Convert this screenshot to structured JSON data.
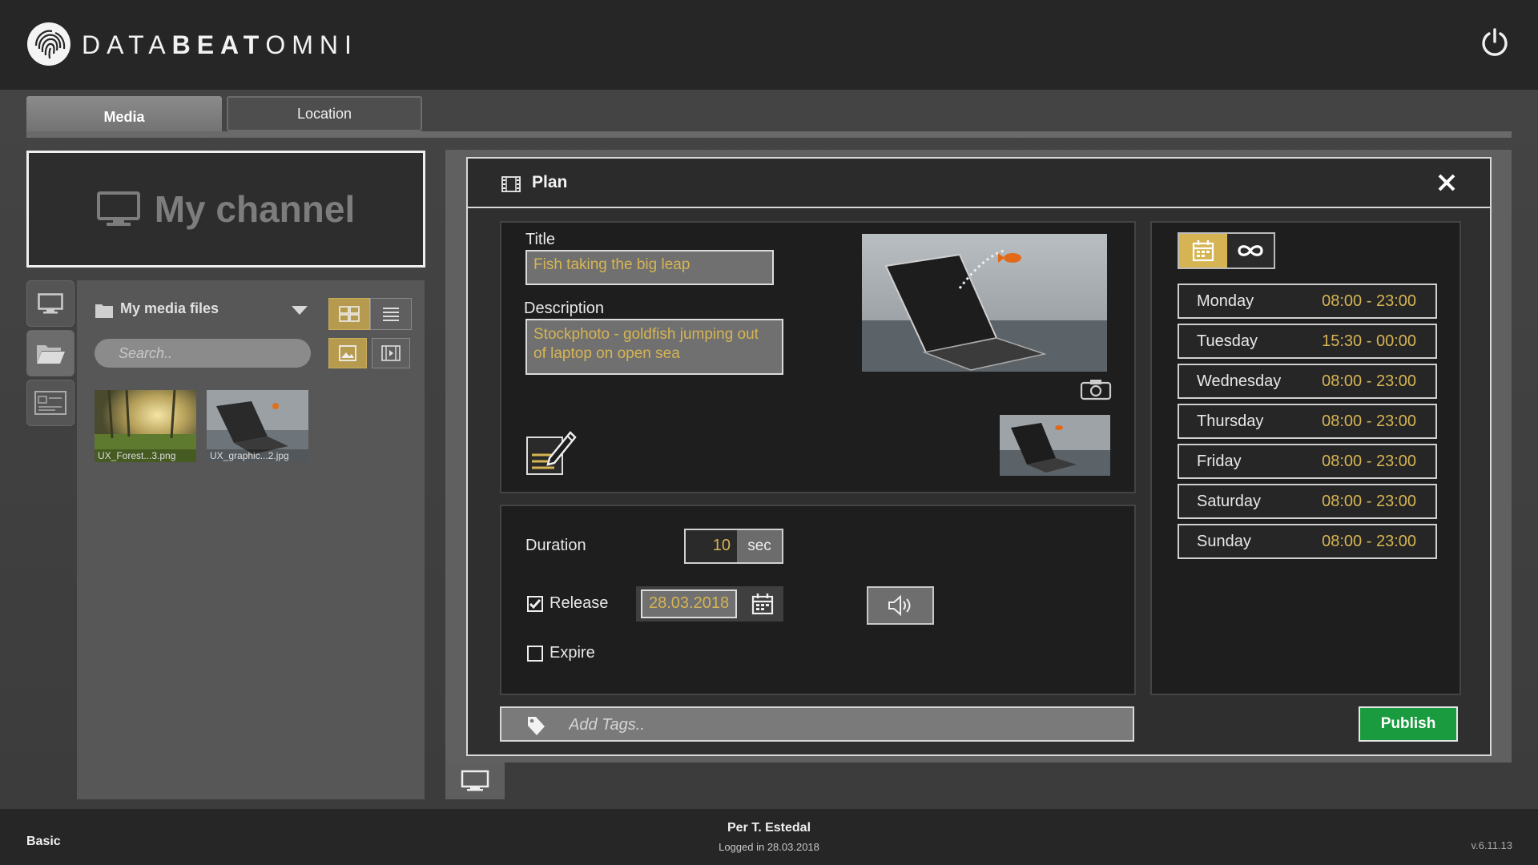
{
  "header": {
    "logo_light": "DATA",
    "logo_bold": "BEAT",
    "logo_end": "OMNI",
    "power_icon": "power-icon"
  },
  "tabs": [
    {
      "label": "Media",
      "active": true
    },
    {
      "label": "Location",
      "active": false
    }
  ],
  "left": {
    "channel_title": "My channel",
    "media_files_label": "My media files",
    "search_placeholder": "Search..",
    "thumbnails": [
      {
        "caption": "UX_Forest...3.png"
      },
      {
        "caption": "UX_graphic...2.jpg"
      }
    ]
  },
  "plan": {
    "title": "Plan",
    "title_label": "Title",
    "title_value": "Fish taking the big leap",
    "description_label": "Description",
    "description_value": "Stockphoto - goldfish jumping out of laptop on open sea",
    "duration_label": "Duration",
    "duration_value": "10",
    "duration_unit": "sec",
    "release_label": "Release",
    "release_checked": true,
    "release_date": "28.03.2018",
    "expire_label": "Expire",
    "expire_checked": false,
    "tags_placeholder": "Add Tags..",
    "publish_label": "Publish",
    "schedule": [
      {
        "day": "Monday",
        "time": "08:00 - 23:00"
      },
      {
        "day": "Tuesday",
        "time": "15:30 - 00:00"
      },
      {
        "day": "Wednesday",
        "time": "08:00 - 23:00"
      },
      {
        "day": "Thursday",
        "time": "08:00 - 23:00"
      },
      {
        "day": "Friday",
        "time": "08:00 - 23:00"
      },
      {
        "day": "Saturday",
        "time": "08:00 - 23:00"
      },
      {
        "day": "Sunday",
        "time": "08:00 - 23:00"
      }
    ]
  },
  "footer": {
    "plan_level": "Basic",
    "user_name": "Per T. Estedal",
    "logged_in": "Logged in 28.03.2018",
    "version": "v.6.11.13"
  },
  "colors": {
    "accent_gold": "#d6b453",
    "publish_green": "#1b9b3f"
  }
}
